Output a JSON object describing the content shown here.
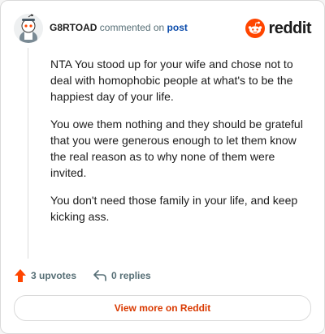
{
  "comment": {
    "username": "G8RTOAD",
    "action_text": "commented on",
    "post_link": "post"
  },
  "brand": {
    "name": "reddit",
    "accent": "#ff4500"
  },
  "body": {
    "paragraphs": [
      "NTA You stood up for your wife and chose not to deal with homophobic people at what's to be the happiest day of your life.",
      "You owe them nothing and they should be grateful that you were generous enough to let them know the real reason as to why none of them were invited.",
      "You don't need those family in your life, and keep kicking ass."
    ]
  },
  "actions": {
    "upvotes": "3 upvotes",
    "replies": "0 replies"
  },
  "footer": {
    "view_more": "View more on Reddit"
  },
  "colors": {
    "upvote": "#ff4500",
    "link": "#0a4bab",
    "view_more": "#d93900"
  }
}
